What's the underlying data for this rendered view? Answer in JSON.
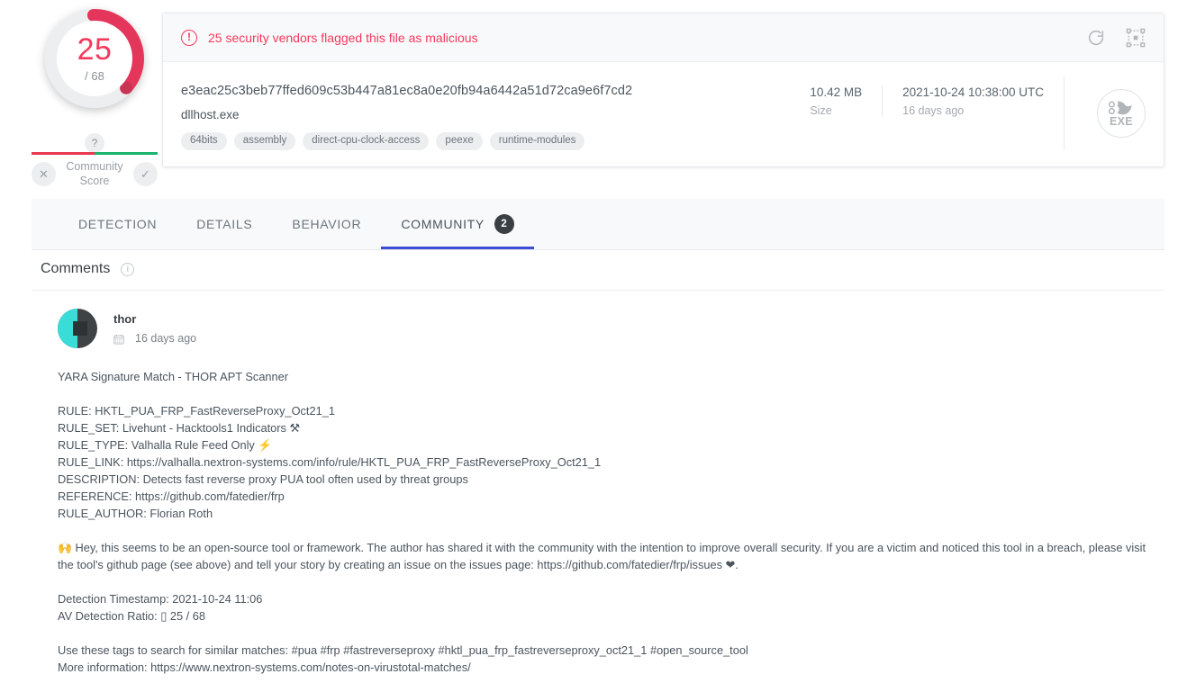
{
  "score": {
    "detections": "25",
    "total": "/ 68",
    "gauge_color": "#e4355a",
    "track_color": "#eceef0"
  },
  "community_score": {
    "question_mark": "?",
    "label_line1": "Community",
    "label_line2": "Score",
    "downvote_icon": "✕",
    "upvote_icon": "✓",
    "negative_color": "#e8374f",
    "positive_color": "#19b36b"
  },
  "alert": {
    "icon": "!",
    "text": "25 security vendors flagged this file as malicious",
    "color": "#f4395c",
    "reload_icon": "reload-icon",
    "focus_icon": "focus-icon"
  },
  "file": {
    "hash": "e3eac25c3beb77ffed609c53b447a81ec8a0e20fb94a6442a51d72ca9e6f7cd2",
    "name": "dllhost.exe",
    "tags": [
      "64bits",
      "assembly",
      "direct-cpu-clock-access",
      "peexe",
      "runtime-modules"
    ],
    "size_value": "10.42 MB",
    "size_label": "Size",
    "date_value": "2021-10-24 10:38:00 UTC",
    "date_label": "16 days ago",
    "type_label": "EXE"
  },
  "tabs": [
    {
      "label": "DETECTION",
      "active": false,
      "badge": null
    },
    {
      "label": "DETAILS",
      "active": false,
      "badge": null
    },
    {
      "label": "BEHAVIOR",
      "active": false,
      "badge": null
    },
    {
      "label": "COMMUNITY",
      "active": true,
      "badge": "2"
    }
  ],
  "comments_section": {
    "title": "Comments",
    "info_icon": "i"
  },
  "comment": {
    "author": "thor",
    "timestamp": "16 days ago",
    "calendar_icon": "calendar-icon",
    "line_title": "YARA Signature Match - THOR APT Scanner",
    "rule": "RULE: HKTL_PUA_FRP_FastReverseProxy_Oct21_1",
    "rule_set": "RULE_SET: Livehunt - Hacktools1 Indicators ⚒",
    "rule_type": "RULE_TYPE: Valhalla Rule Feed Only ⚡",
    "rule_link": "RULE_LINK: https://valhalla.nextron-systems.com/info/rule/HKTL_PUA_FRP_FastReverseProxy_Oct21_1",
    "description": "DESCRIPTION: Detects fast reverse proxy PUA tool often used by threat groups",
    "reference": "REFERENCE: https://github.com/fatedier/frp",
    "rule_author": "RULE_AUTHOR: Florian Roth",
    "notice": "🙌 Hey, this seems to be an open-source tool or framework. The author has shared it with the community with the intention to improve overall security. If you are a victim and noticed this tool in a breach, please visit the tool's github page (see above) and tell your story by creating an issue on the issues page: https://github.com/fatedier/frp/issues ❤.",
    "detection_timestamp": "Detection Timestamp: 2021-10-24 11:06",
    "av_detection_ratio": "AV Detection Ratio: ▯ 25 / 68",
    "tags_line": "Use these tags to search for similar matches: #pua #frp #fastreverseproxy #hktl_pua_frp_fastreverseproxy_oct21_1 #open_source_tool",
    "more_info": "More information: https://www.nextron-systems.com/notes-on-virustotal-matches/"
  }
}
